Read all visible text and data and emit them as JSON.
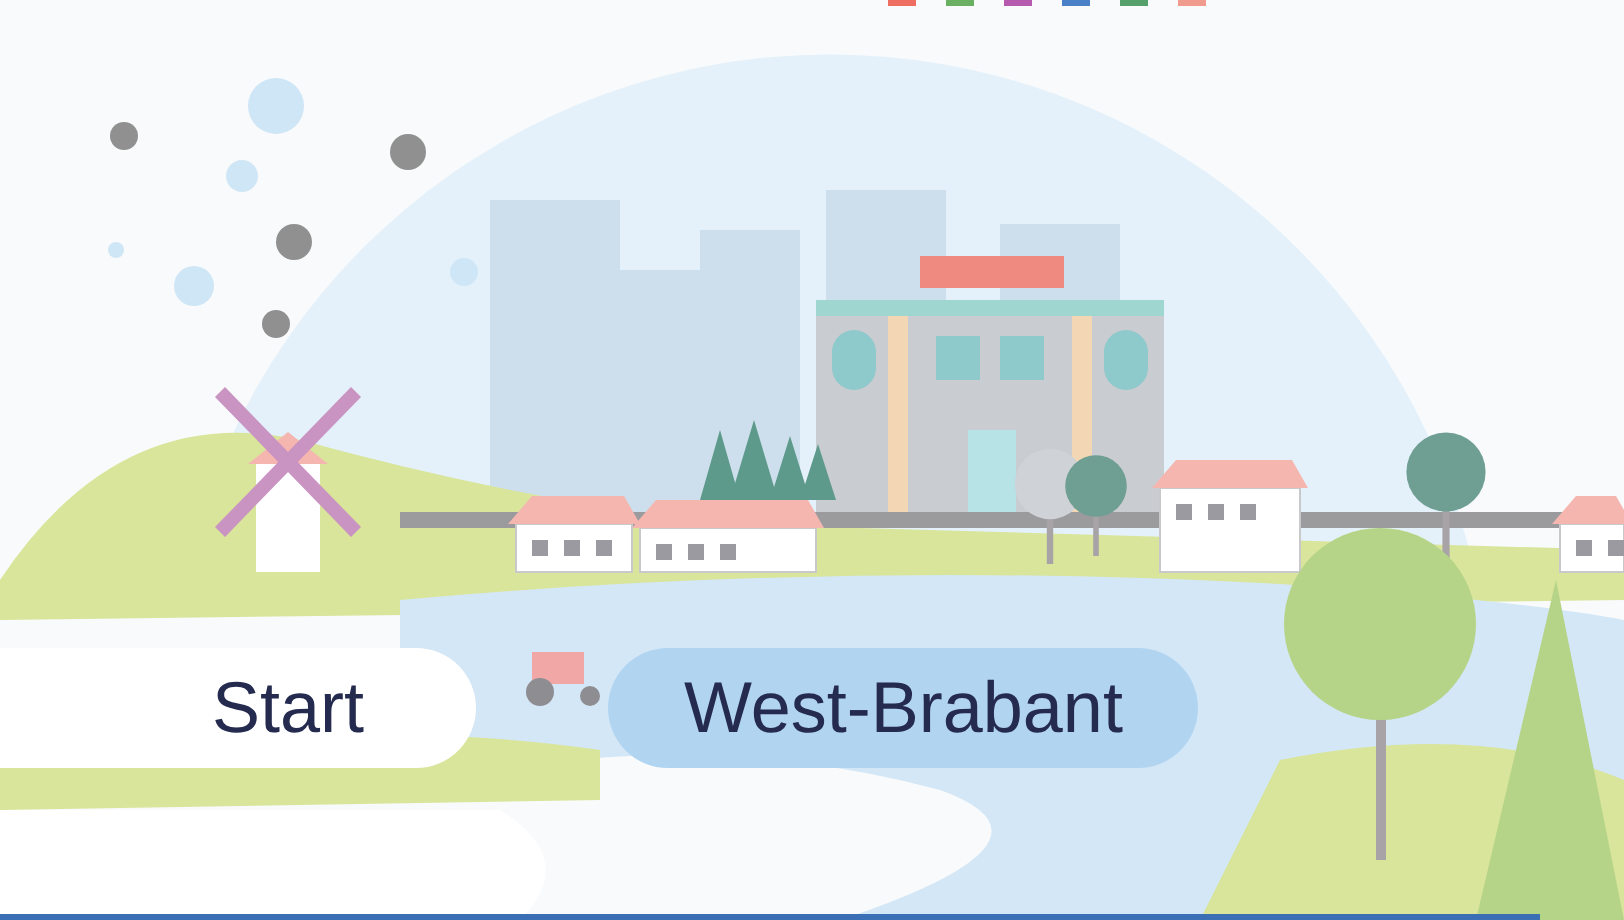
{
  "breadcrumb": [
    {
      "label": "Start",
      "selected": false
    },
    {
      "label": "West-Brabant",
      "selected": true
    }
  ]
}
